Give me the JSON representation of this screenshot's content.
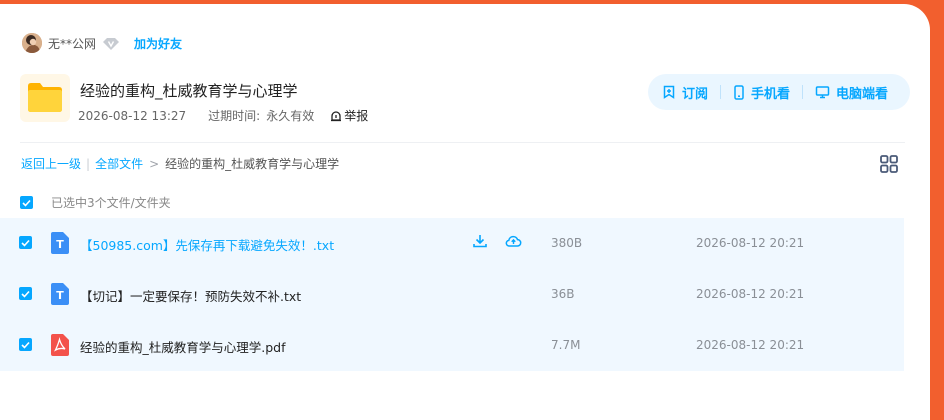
{
  "user": {
    "name": "无**公网",
    "add_friend": "加为好友"
  },
  "share": {
    "title": "经验的重构_杜威教育学与心理学",
    "date": "2026-08-12 13:27",
    "expire_label": "过期时间:",
    "expire_value": "永久有效",
    "report": "举报"
  },
  "actions": {
    "subscribe": "订阅",
    "mobile": "手机看",
    "desktop": "电脑端看"
  },
  "breadcrumb": {
    "back": "返回上一级",
    "all_files": "全部文件",
    "current": "经验的重构_杜威教育学与心理学"
  },
  "selection": {
    "text": "已选中3个文件/文件夹"
  },
  "files": [
    {
      "name": "【50985.com】先保存再下载避免失效！.txt",
      "size": "380B",
      "time": "2026-08-12 20:21",
      "type": "txt-icon",
      "type_letter": "T"
    },
    {
      "name": "【切记】一定要保存！预防失效不补.txt",
      "size": "36B",
      "time": "2026-08-12 20:21",
      "type": "txt-icon",
      "type_letter": "T"
    },
    {
      "name": "经验的重构_杜威教育学与心理学.pdf",
      "size": "7.7M",
      "time": "2026-08-12 20:21",
      "type": "pdf-icon"
    }
  ],
  "colors": {
    "accent": "#06a7ff",
    "background": "#f25f2e",
    "row_bg": "#f0f8ff",
    "folder": "#ffc21a",
    "pdf": "#f3524b",
    "txt": "#3b8ff6"
  }
}
